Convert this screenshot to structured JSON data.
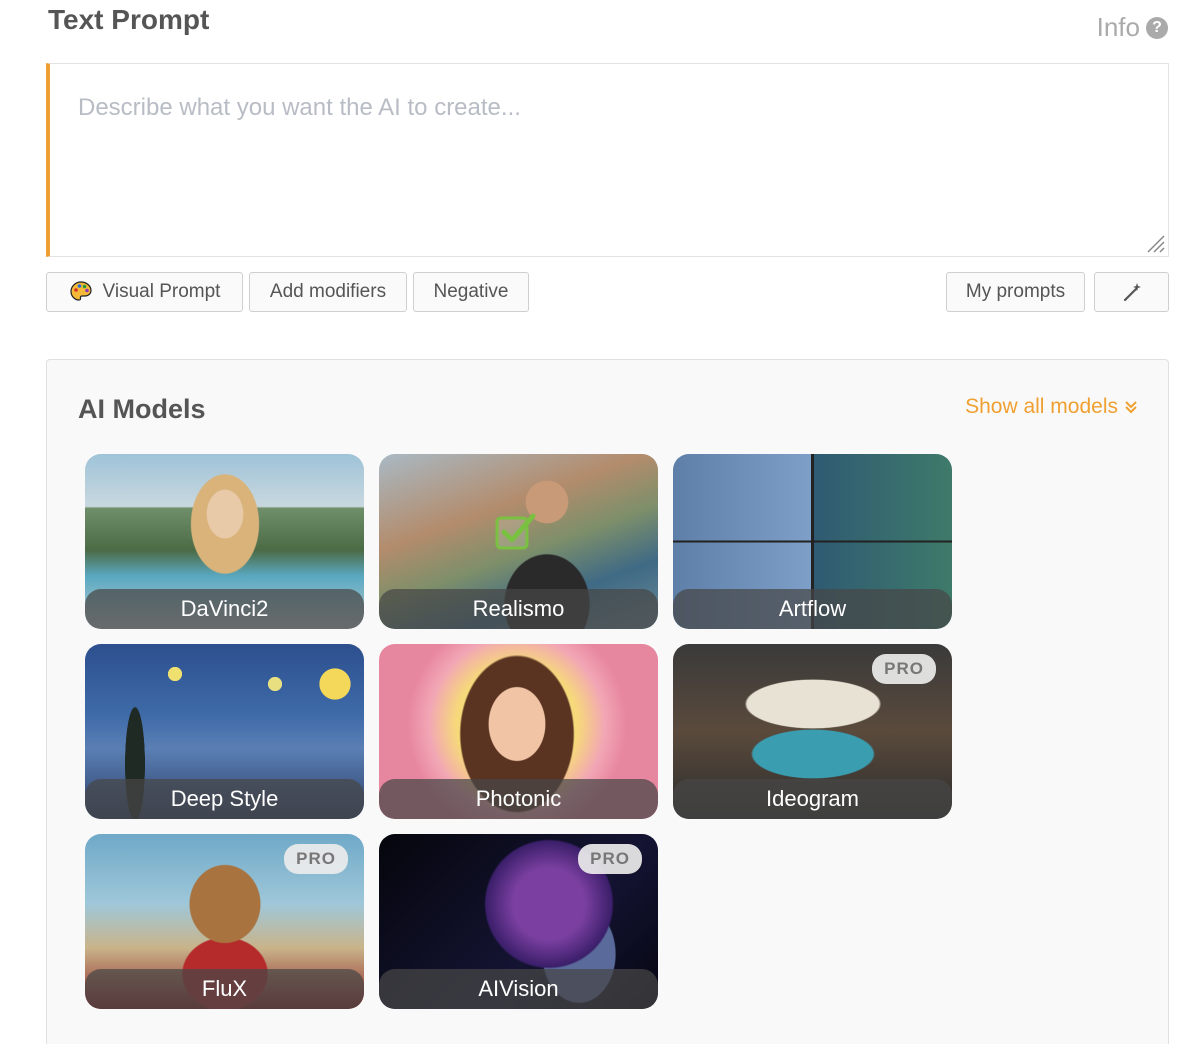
{
  "header": {
    "title": "Text Prompt",
    "info_label": "Info",
    "info_icon": "question-circle-icon"
  },
  "prompt": {
    "placeholder": "Describe what you want the AI to create...",
    "value": "",
    "accent_color": "#f0a030"
  },
  "toolbar": {
    "visual_prompt_label": "Visual Prompt",
    "visual_prompt_icon": "palette-icon",
    "add_modifiers_label": "Add modifiers",
    "negative_label": "Negative",
    "my_prompts_label": "My prompts",
    "wand_icon": "magic-wand-icon"
  },
  "models": {
    "title": "AI Models",
    "show_all_label": "Show all models",
    "show_all_icon": "double-chevron-down-icon",
    "selected": "Realismo",
    "items": [
      {
        "name": "DaVinci2",
        "pro": false,
        "selected": false
      },
      {
        "name": "Realismo",
        "pro": false,
        "selected": true
      },
      {
        "name": "Artflow",
        "pro": false,
        "selected": false
      },
      {
        "name": "Deep Style",
        "pro": false,
        "selected": false
      },
      {
        "name": "Photonic",
        "pro": false,
        "selected": false
      },
      {
        "name": "Ideogram",
        "pro": true,
        "selected": false
      },
      {
        "name": "FluX",
        "pro": true,
        "selected": false
      },
      {
        "name": "AIVision",
        "pro": true,
        "selected": false
      }
    ],
    "pro_label": "PRO"
  },
  "colors": {
    "accent": "#f0a030",
    "check_green": "#7ac142"
  }
}
